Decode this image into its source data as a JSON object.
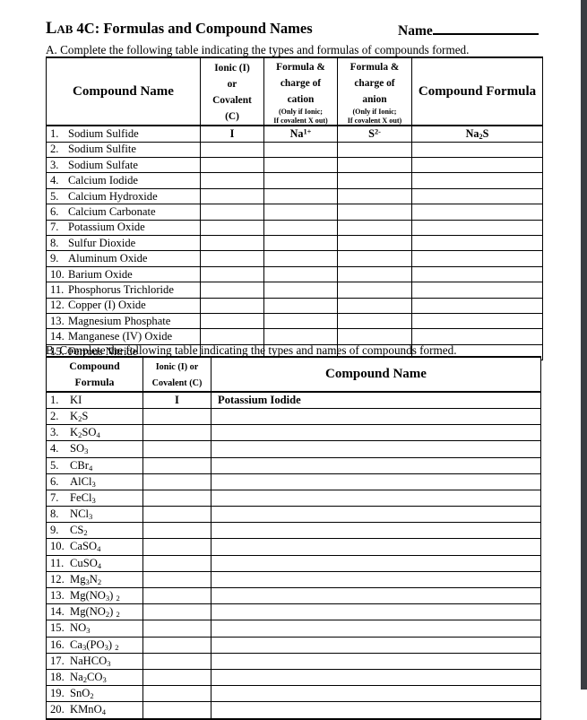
{
  "header": {
    "title_small": "Lab",
    "title_rest": " 4C: Formulas and Compound Names",
    "name_label": "Name"
  },
  "section_a": {
    "instruction": "A.  Complete the following table indicating the types and formulas of compounds formed.",
    "headers": {
      "compound_name": "Compound Name",
      "type_line1": "Ionic (I)",
      "type_line2": "or",
      "type_line3": "Covalent",
      "type_line4": "(C)",
      "cation_line1": "Formula &",
      "cation_line2": "charge of",
      "cation_line3": "cation",
      "cation_note1": "(Only if Ionic;",
      "cation_note2": "If covalent X out)",
      "anion_line1": "Formula &",
      "anion_line2": "charge of",
      "anion_line3": "anion",
      "anion_note1": "(Only if Ionic;",
      "anion_note2": "If covalent X out)",
      "compound_formula": "Compound Formula"
    },
    "rows": [
      {
        "num": "1.",
        "name": "Sodium Sulfide",
        "type": "I",
        "cation_html": "Na<sup>1+</sup>",
        "anion_html": "S<sup>2-</sup>",
        "formula_html": "Na<sub>2</sub>S"
      },
      {
        "num": "2.",
        "name": "Sodium Sulfite",
        "type": "",
        "cation_html": "",
        "anion_html": "",
        "formula_html": ""
      },
      {
        "num": "3.",
        "name": "Sodium Sulfate",
        "type": "",
        "cation_html": "",
        "anion_html": "",
        "formula_html": ""
      },
      {
        "num": "4.",
        "name": "Calcium Iodide",
        "type": "",
        "cation_html": "",
        "anion_html": "",
        "formula_html": ""
      },
      {
        "num": "5.",
        "name": "Calcium Hydroxide",
        "type": "",
        "cation_html": "",
        "anion_html": "",
        "formula_html": ""
      },
      {
        "num": "6.",
        "name": "Calcium Carbonate",
        "type": "",
        "cation_html": "",
        "anion_html": "",
        "formula_html": ""
      },
      {
        "num": "7.",
        "name": "Potassium Oxide",
        "type": "",
        "cation_html": "",
        "anion_html": "",
        "formula_html": ""
      },
      {
        "num": "8.",
        "name": "Sulfur Dioxide",
        "type": "",
        "cation_html": "",
        "anion_html": "",
        "formula_html": ""
      },
      {
        "num": "9.",
        "name": "Aluminum Oxide",
        "type": "",
        "cation_html": "",
        "anion_html": "",
        "formula_html": ""
      },
      {
        "num": "10.",
        "name": "Barium Oxide",
        "type": "",
        "cation_html": "",
        "anion_html": "",
        "formula_html": ""
      },
      {
        "num": "11.",
        "name": "Phosphorus Trichloride",
        "type": "",
        "cation_html": "",
        "anion_html": "",
        "formula_html": ""
      },
      {
        "num": "12.",
        "name": "Copper (I) Oxide",
        "type": "",
        "cation_html": "",
        "anion_html": "",
        "formula_html": ""
      },
      {
        "num": "13.",
        "name": "Magnesium Phosphate",
        "type": "",
        "cation_html": "",
        "anion_html": "",
        "formula_html": ""
      },
      {
        "num": "14.",
        "name": "Manganese (IV) Oxide",
        "type": "",
        "cation_html": "",
        "anion_html": "",
        "formula_html": ""
      },
      {
        "num": "15.",
        "name": "Ferrous Nitride",
        "type": "",
        "cation_html": "",
        "anion_html": "",
        "formula_html": ""
      }
    ]
  },
  "section_b": {
    "instruction": "B.  Complete the following table indicating the types and names of compounds formed.",
    "headers": {
      "formula_line1": "Compound",
      "formula_line2": "Formula",
      "type_line1": "Ionic (I) or",
      "type_line2": "Covalent (C)",
      "compound_name": "Compound Name"
    },
    "rows": [
      {
        "num": "1.",
        "formula_html": "KI",
        "type": "I",
        "name": "Potassium Iodide"
      },
      {
        "num": "2.",
        "formula_html": "K<sub>2</sub>S",
        "type": "",
        "name": ""
      },
      {
        "num": "3.",
        "formula_html": "K<sub>2</sub>SO<sub>4</sub>",
        "type": "",
        "name": ""
      },
      {
        "num": "4.",
        "formula_html": "SO<sub>3</sub>",
        "type": "",
        "name": ""
      },
      {
        "num": "5.",
        "formula_html": "CBr<sub>4</sub>",
        "type": "",
        "name": ""
      },
      {
        "num": "6.",
        "formula_html": "AlCl<sub>3</sub>",
        "type": "",
        "name": ""
      },
      {
        "num": "7.",
        "formula_html": "FeCl<sub>3</sub>",
        "type": "",
        "name": ""
      },
      {
        "num": "8.",
        "formula_html": "NCl<sub>3</sub>",
        "type": "",
        "name": ""
      },
      {
        "num": "9.",
        "formula_html": "CS<sub>2</sub>",
        "type": "",
        "name": ""
      },
      {
        "num": "10.",
        "formula_html": "CaSO<sub>4</sub>",
        "type": "",
        "name": ""
      },
      {
        "num": "11.",
        "formula_html": "CuSO<sub>4</sub>",
        "type": "",
        "name": ""
      },
      {
        "num": "12.",
        "formula_html": "Mg<sub>3</sub>N<sub>2</sub>",
        "type": "",
        "name": ""
      },
      {
        "num": "13.",
        "formula_html": "Mg(NO<sub>3</sub>)&nbsp;<sub>2</sub>",
        "type": "",
        "name": ""
      },
      {
        "num": "14.",
        "formula_html": "Mg(NO<sub>2</sub>)&nbsp;<sub>2</sub>",
        "type": "",
        "name": ""
      },
      {
        "num": "15.",
        "formula_html": "NO<sub>3</sub>",
        "type": "",
        "name": ""
      },
      {
        "num": "16.",
        "formula_html": "Ca<sub>3</sub>(PO<sub>3</sub>)&nbsp;<sub>2</sub>",
        "type": "",
        "name": ""
      },
      {
        "num": "17.",
        "formula_html": "NaHCO<sub>3</sub>",
        "type": "",
        "name": ""
      },
      {
        "num": "18.",
        "formula_html": "Na<sub>2</sub>CO<sub>3</sub>",
        "type": "",
        "name": ""
      },
      {
        "num": "19.",
        "formula_html": "SnO<sub>2</sub>",
        "type": "",
        "name": ""
      },
      {
        "num": "20.",
        "formula_html": "KMnO<sub>4</sub>",
        "type": "",
        "name": ""
      }
    ]
  }
}
